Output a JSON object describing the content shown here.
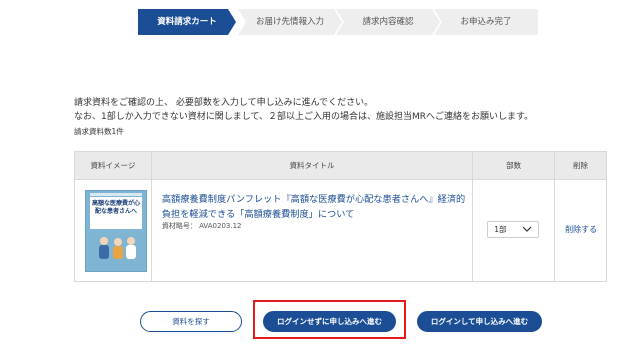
{
  "steps": [
    {
      "label": "資料請求カート"
    },
    {
      "label": "お届け先情報入力"
    },
    {
      "label": "請求内容確認"
    },
    {
      "label": "お申込み完了"
    }
  ],
  "intro": {
    "line1": "請求資料をご確認の上、 必要部数を入力して申し込みに進んでください。",
    "line2": "なお、1部しか入力できない資材に関しまして、２部以上ご入用の場合は、施設担当MRへご連絡をお願いします。",
    "count": "請求資料数1件"
  },
  "table": {
    "headers": {
      "image": "資料イメージ",
      "title": "資料タイトル",
      "qty": "部数",
      "delete": "削除"
    },
    "rows": [
      {
        "thumbnail_caption": "高額な医療費が心配な患者さんへ",
        "title": "高額療養費制度パンフレット『高額な医療費が心配な患者さんへ』経済的負担を軽減できる「高額療養費制度」について",
        "material_no": "資材略号： AVA0203.12",
        "qty": "1部",
        "delete": "削除する"
      }
    ]
  },
  "buttons": {
    "search": "資料を探す",
    "guest": "ログインせずに申し込みへ進む",
    "login": "ログインして申し込みへ進む"
  },
  "colors": {
    "accent": "#1c4e96",
    "highlight": "#e21a1a"
  }
}
